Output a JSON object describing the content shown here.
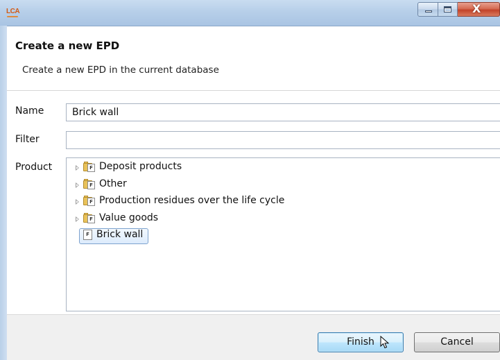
{
  "window": {
    "app_icon_text": "LCA",
    "controls": {
      "minimize": "minimize",
      "maximize": "maximize",
      "close": "X"
    }
  },
  "header": {
    "title": "Create a new EPD",
    "subtitle": "Create a new EPD in the current database"
  },
  "form": {
    "name_label": "Name",
    "name_value": "Brick wall",
    "filter_label": "Filter",
    "filter_value": "",
    "product_label": "Product"
  },
  "tree": {
    "items": [
      {
        "label": "Deposit products",
        "type": "folder",
        "expandable": true
      },
      {
        "label": "Other",
        "type": "folder",
        "expandable": true
      },
      {
        "label": "Production residues over the life cycle",
        "type": "folder",
        "expandable": true
      },
      {
        "label": "Value goods",
        "type": "folder",
        "expandable": true
      },
      {
        "label": "Brick wall",
        "type": "product",
        "selected": true
      }
    ],
    "icon_glyph": "F"
  },
  "footer": {
    "finish_label": "Finish",
    "cancel_label": "Cancel"
  },
  "colors": {
    "titlebar": "#b7cfe9",
    "close_button": "#c2432a",
    "selection": "#dcebfc",
    "default_button": "#bee6fd"
  }
}
